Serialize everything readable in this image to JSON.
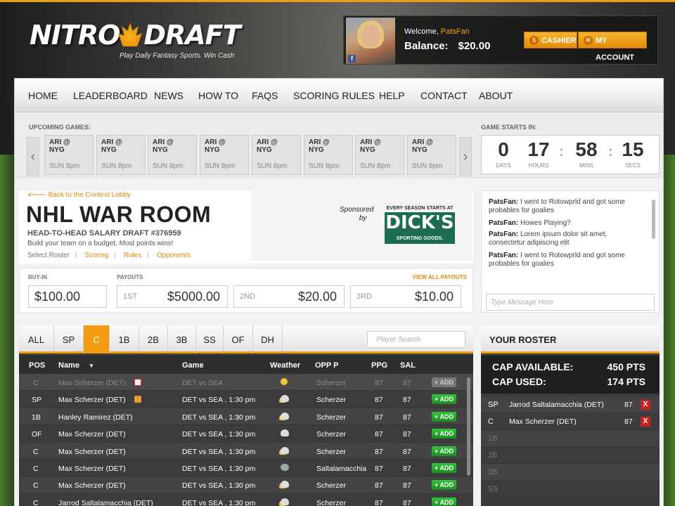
{
  "brand": {
    "logo_left": "NITRO",
    "logo_right": "DRAFT",
    "tagline": "Play Daily Fantasy Sports. Win Cash",
    "accent": "#f39c12"
  },
  "user": {
    "welcome": "Welcome,",
    "username": "PatsFan",
    "balance_label": "Balance:",
    "balance": "$20.00",
    "fb_icon": "f"
  },
  "header": {
    "cashier": "CASHIER",
    "account": "MY ACCOUNT"
  },
  "nav": [
    "HOME",
    "LEADERBOARD",
    "NEWS",
    "HOW TO",
    "FAQS",
    "SCORING RULES",
    "HELP",
    "CONTACT",
    "ABOUT"
  ],
  "upcoming": {
    "label": "UPCOMING GAMES:",
    "prev": "‹",
    "next": "›",
    "games": [
      {
        "l1": "ARI @",
        "l2": "NYG",
        "time": "SUN 8pm"
      },
      {
        "l1": "ARI @",
        "l2": "NYG",
        "time": "SUN 8pm"
      },
      {
        "l1": "ARI @",
        "l2": "NYG",
        "time": "SUN 8pm"
      },
      {
        "l1": "ARI @",
        "l2": "NYG",
        "time": "SUN 8pm"
      },
      {
        "l1": "ARI @",
        "l2": "NYG",
        "time": "SUN 8pm"
      },
      {
        "l1": "ARI @",
        "l2": "NYG",
        "time": "SUN 8pm"
      },
      {
        "l1": "ARI @",
        "l2": "NYG",
        "time": "SUN 8pm"
      },
      {
        "l1": "ARI @",
        "l2": "NYG",
        "time": "SUN 8pm"
      }
    ]
  },
  "countdown": {
    "label": "GAME STARTS IN:",
    "days": "0",
    "days_l": "DAYS",
    "hours": "17",
    "hours_l": "HOURS",
    "mins": "58",
    "mins_l": "MINS",
    "secs": "15",
    "secs_l": "SECS"
  },
  "contest": {
    "back": "Back to the Contest Lobby",
    "title": "NHL WAR ROOM",
    "subtitle": "HEAD-TO-HEAD SALARY DRAFT #376959",
    "desc": "Build your team on a budget. Most points wins!",
    "link0": "Select Roster",
    "link1": "Scoring",
    "link2": "Rules",
    "link3": "Opponents"
  },
  "sponsor": {
    "by1": "Sponsored",
    "by2": "by",
    "top": "EVERY SEASON STARTS AT",
    "name": "DICK'S",
    "bottom": "SPORTING GOODS."
  },
  "payouts": {
    "buyin_label": "BUY-IN",
    "buyin": "$100.00",
    "payouts_label": "PAYOUTS",
    "view_all": "VIEW ALL PAYOUTS",
    "p1l": "1ST",
    "p1": "$5000.00",
    "p2l": "2ND",
    "p2": "$20.00",
    "p3l": "3RD",
    "p3": "$10.00"
  },
  "chat": {
    "placeholder": "Type Message Here",
    "messages": [
      {
        "user": "PatsFan:",
        "text": "I went to Rotowprld and got some probables for goalies"
      },
      {
        "user": "PatsFan:",
        "text": "Howes Playing?"
      },
      {
        "user": "PatsFan:",
        "text": "Lorem ipsum dolor sit amet, consectetur adipiscing elit"
      },
      {
        "user": "PatsFan:",
        "text": "I went to Rotowprld and got some probables for goalies"
      }
    ]
  },
  "tabs": [
    "ALL",
    "SP",
    "C",
    "1B",
    "2B",
    "3B",
    "SS",
    "OF",
    "DH"
  ],
  "search_placeholder": "Player Search",
  "columns": {
    "pos": "POS",
    "name": "Name",
    "game": "Game",
    "weather": "Weather",
    "opp": "OPP P",
    "ppg": "PPG",
    "sal": "SAL"
  },
  "players": [
    {
      "pos": "C",
      "name": "Max Scherzer (DET)",
      "game": "DET vs SEA",
      "opp": "Scherzer",
      "ppg": "87",
      "sal": "87",
      "add": "+ ADD"
    },
    {
      "pos": "SP",
      "name": "Max Scherzer (DET)",
      "game": "DET vs SEA , 1:30 pm",
      "opp": "Scherzer",
      "ppg": "87",
      "sal": "87",
      "add": "+ ADD"
    },
    {
      "pos": "1B",
      "name": "Hanley Ramirez (DET)",
      "game": "DET vs SEA , 1:30 pm",
      "opp": "Scherzer",
      "ppg": "87",
      "sal": "87",
      "add": "+ ADD"
    },
    {
      "pos": "OF",
      "name": "Max Scherzer (DET)",
      "game": "DET vs SEA , 1:30 pm",
      "opp": "Scherzer",
      "ppg": "87",
      "sal": "87",
      "add": "+ ADD"
    },
    {
      "pos": "C",
      "name": "Max Scherzer (DET)",
      "game": "DET vs SEA , 1:30 pm",
      "opp": "Scherzer",
      "ppg": "87",
      "sal": "87",
      "add": "+ ADD"
    },
    {
      "pos": "C",
      "name": "Max Scherzer (DET)",
      "game": "DET vs SEA , 1:30 pm",
      "opp": "Saltalamacchia",
      "ppg": "87",
      "sal": "87",
      "add": "+ ADD"
    },
    {
      "pos": "C",
      "name": "Max Scherzer (DET)",
      "game": "DET vs SEA , 1:30 pm",
      "opp": "Scherzer",
      "ppg": "87",
      "sal": "87",
      "add": "+ ADD"
    },
    {
      "pos": "C",
      "name": "Jarrod Saltalamacchia (DET)",
      "game": "DET vs SEA , 1:30 pm",
      "opp": "Scherzer",
      "ppg": "87",
      "sal": "87",
      "add": "+ ADD"
    }
  ],
  "roster": {
    "title": "YOUR ROSTER",
    "cap_avail_l": "CAP AVAILABLE:",
    "cap_avail": "450 PTS",
    "cap_used_l": "CAP USED:",
    "cap_used": "174 PTS",
    "filled": [
      {
        "pos": "SP",
        "name": "Jarrod Saltalamacchia (DET)",
        "pts": "87",
        "remove": "X"
      },
      {
        "pos": "C",
        "name": "Max Scherzer (DET)",
        "pts": "87",
        "remove": "X"
      }
    ],
    "empty": [
      "1B",
      "2B",
      "3B",
      "SS"
    ]
  }
}
